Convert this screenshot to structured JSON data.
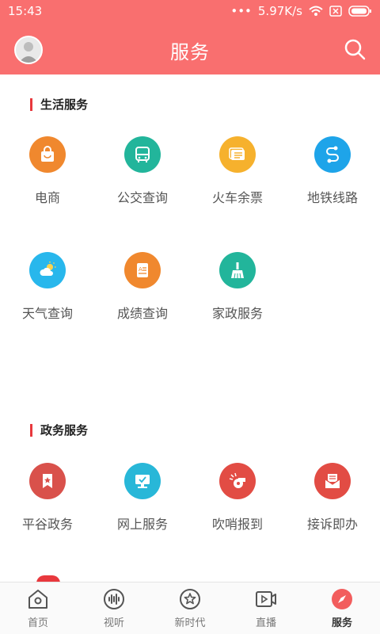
{
  "status": {
    "time": "15:43",
    "speed": "5.97K/s"
  },
  "header": {
    "title": "服务"
  },
  "sections": [
    {
      "title": "生活服务",
      "items": [
        {
          "label": "电商",
          "icon": "shopping-bag-icon",
          "color": "#f0882e"
        },
        {
          "label": "公交查询",
          "icon": "bus-icon",
          "color": "#22b59b"
        },
        {
          "label": "火车余票",
          "icon": "ticket-icon",
          "color": "#f6b12d"
        },
        {
          "label": "地铁线路",
          "icon": "route-icon",
          "color": "#1ea4e9"
        },
        {
          "label": "天气查询",
          "icon": "weather-icon",
          "color": "#28b7ec"
        },
        {
          "label": "成绩查询",
          "icon": "report-icon",
          "color": "#f0882e"
        },
        {
          "label": "家政服务",
          "icon": "broom-icon",
          "color": "#22b59b"
        }
      ]
    },
    {
      "title": "政务服务",
      "items": [
        {
          "label": "平谷政务",
          "icon": "bookmark-star-icon",
          "color": "#d9514b"
        },
        {
          "label": "网上服务",
          "icon": "monitor-check-icon",
          "color": "#28b7d8"
        },
        {
          "label": "吹哨报到",
          "icon": "whistle-icon",
          "color": "#e24c44"
        },
        {
          "label": "接诉即办",
          "icon": "mail-icon",
          "color": "#e24c44"
        }
      ]
    }
  ],
  "nav": [
    {
      "label": "首页",
      "icon": "home-icon"
    },
    {
      "label": "视听",
      "icon": "audio-wave-icon"
    },
    {
      "label": "新时代",
      "icon": "star-circle-icon"
    },
    {
      "label": "直播",
      "icon": "video-icon"
    },
    {
      "label": "服务",
      "icon": "compass-icon",
      "active": true
    }
  ]
}
